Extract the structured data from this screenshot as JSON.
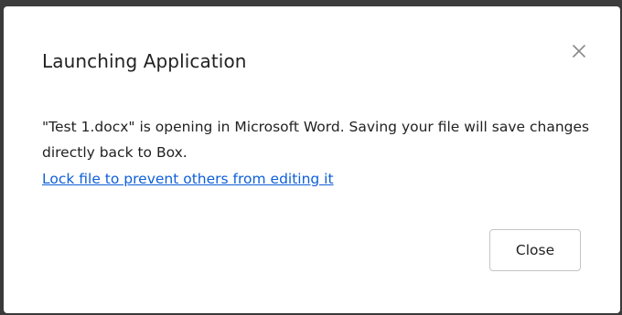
{
  "dialog": {
    "title": "Launching Application",
    "message": "\"Test 1.docx\" is opening in Microsoft Word. Saving your file will save changes directly back to Box.",
    "lock_link": "Lock file to prevent others from editing it",
    "close_button_label": "Close",
    "close_icon": "close-icon"
  },
  "colors": {
    "link": "#0e5fd8",
    "backdrop": "#3a3a3a",
    "text": "#222222"
  }
}
